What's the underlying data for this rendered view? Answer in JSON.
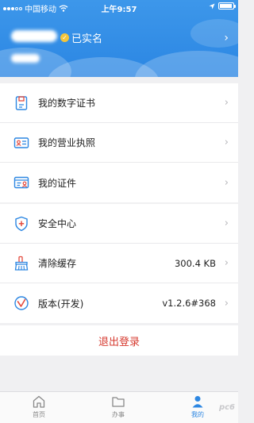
{
  "status_bar": {
    "carrier": "中国移动",
    "time": "上午9:57"
  },
  "header": {
    "verified_label": "已实名"
  },
  "menu_group_1": [
    {
      "label": "我的数字证书",
      "icon": "digital-certificate-icon"
    },
    {
      "label": "我的营业执照",
      "icon": "business-license-icon"
    },
    {
      "label": "我的证件",
      "icon": "id-card-icon"
    }
  ],
  "menu_group_2": [
    {
      "label": "安全中心",
      "icon": "shield-icon",
      "value": ""
    },
    {
      "label": "清除缓存",
      "icon": "broom-icon",
      "value": "300.4 KB"
    },
    {
      "label": "版本(开发)",
      "icon": "version-icon",
      "value": "v1.2.6#368"
    }
  ],
  "logout_label": "退出登录",
  "tabbar": {
    "tabs": [
      {
        "label": "首页",
        "icon": "home-icon",
        "active": false
      },
      {
        "label": "办事",
        "icon": "folder-icon",
        "active": false
      },
      {
        "label": "我的",
        "icon": "user-icon",
        "active": true
      }
    ]
  },
  "watermark": "pc6",
  "colors": {
    "header_blue": "#2b86e3",
    "accent_blue": "#2d87e2",
    "logout_red": "#d63a2f",
    "verified_gold": "#f3c53b"
  }
}
